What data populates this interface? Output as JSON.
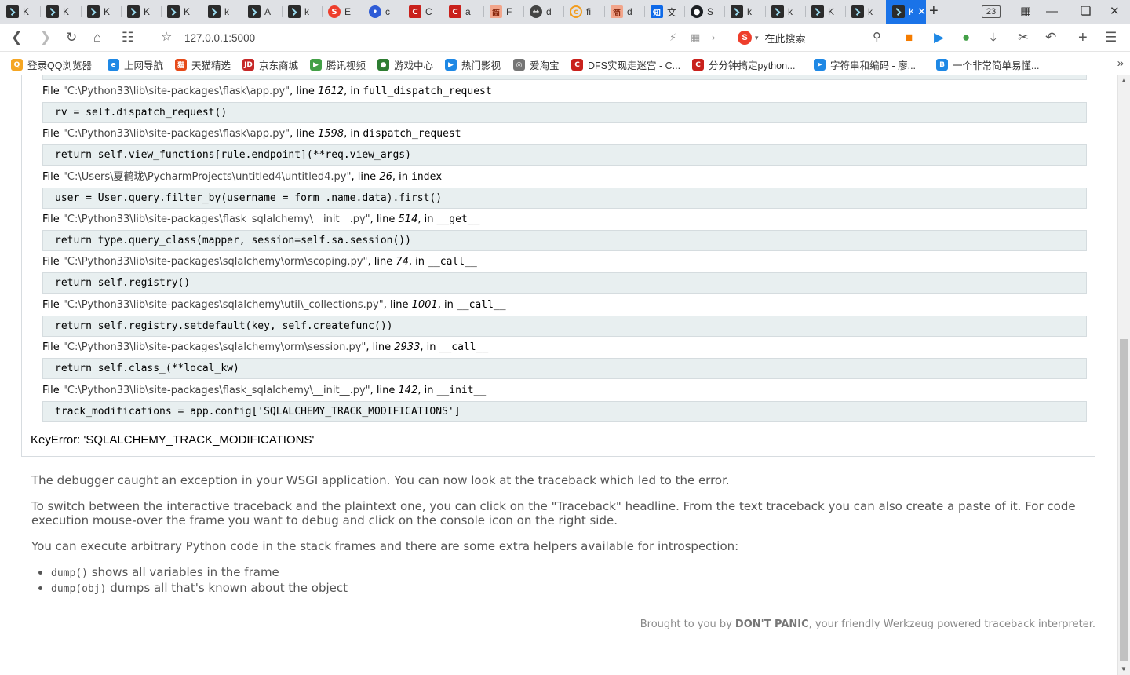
{
  "browser": {
    "tabs": [
      {
        "icon": "terminal-icon",
        "label": "K"
      },
      {
        "icon": "terminal-icon",
        "label": "K"
      },
      {
        "icon": "terminal-icon",
        "label": "K"
      },
      {
        "icon": "terminal-icon",
        "label": "K"
      },
      {
        "icon": "terminal-icon",
        "label": "K"
      },
      {
        "icon": "terminal-icon",
        "label": "k"
      },
      {
        "icon": "terminal-icon",
        "label": "A"
      },
      {
        "icon": "terminal-icon",
        "label": "k"
      },
      {
        "icon": "sogou-icon",
        "label": "E"
      },
      {
        "icon": "baidu-icon",
        "label": "c"
      },
      {
        "icon": "csdn-icon",
        "label": "C"
      },
      {
        "icon": "csdn-icon",
        "label": "a"
      },
      {
        "icon": "jianshu-icon",
        "label": "F"
      },
      {
        "icon": "dark-icon",
        "label": "d"
      },
      {
        "icon": "orange-icon",
        "label": "fi"
      },
      {
        "icon": "jianshu-icon",
        "label": "d"
      },
      {
        "icon": "zhihu-icon",
        "label": "文"
      },
      {
        "icon": "github-icon",
        "label": "S"
      },
      {
        "icon": "terminal-icon",
        "label": "k"
      },
      {
        "icon": "terminal-icon",
        "label": "k"
      },
      {
        "icon": "terminal-icon",
        "label": "K"
      },
      {
        "icon": "terminal-icon",
        "label": "k"
      },
      {
        "icon": "terminal-icon",
        "label": "K"
      }
    ],
    "tab_count": "23",
    "url": "127.0.0.1:5000",
    "search_placeholder": "在此搜索",
    "bookmarks": [
      {
        "label": "登录QQ浏览器",
        "color": "#f5a623"
      },
      {
        "label": "上网导航",
        "color": "#1e88e5"
      },
      {
        "label": "天猫精选",
        "color": "#e64a19"
      },
      {
        "label": "京东商城",
        "color": "#c62828"
      },
      {
        "label": "腾讯视频",
        "color": "#43a047"
      },
      {
        "label": "游戏中心",
        "color": "#2e7d32"
      },
      {
        "label": "热门影视",
        "color": "#1e88e5"
      },
      {
        "label": "爱淘宝",
        "color": "#757575"
      },
      {
        "label": "DFS实现走迷宫 - C...",
        "color": "#c9211c"
      },
      {
        "label": "分分钟搞定python...",
        "color": "#c9211c"
      },
      {
        "label": "字符串和编码 - 廖...",
        "color": "#1e88e5"
      },
      {
        "label": "一个非常简单易懂...",
        "color": "#1e88e5"
      }
    ]
  },
  "traceback": {
    "frames": [
      {
        "file": "\"C:\\Python33\\lib\\site-packages\\flask\\app.py\"",
        "line": "1612",
        "func": "full_dispatch_request",
        "code": "rv = self.dispatch_request()"
      },
      {
        "file": "\"C:\\Python33\\lib\\site-packages\\flask\\app.py\"",
        "line": "1598",
        "func": "dispatch_request",
        "code": "return self.view_functions[rule.endpoint](**req.view_args)"
      },
      {
        "file": "\"C:\\Users\\夏鹤珑\\PycharmProjects\\untitled4\\untitled4.py\"",
        "line": "26",
        "func": "index",
        "code": "user = User.query.filter_by(username = form .name.data).first()"
      },
      {
        "file": "\"C:\\Python33\\lib\\site-packages\\flask_sqlalchemy\\__init__.py\"",
        "line": "514",
        "func": "__get__",
        "code": "return type.query_class(mapper, session=self.sa.session())"
      },
      {
        "file": "\"C:\\Python33\\lib\\site-packages\\sqlalchemy\\orm\\scoping.py\"",
        "line": "74",
        "func": "__call__",
        "code": "return self.registry()"
      },
      {
        "file": "\"C:\\Python33\\lib\\site-packages\\sqlalchemy\\util\\_collections.py\"",
        "line": "1001",
        "func": "__call__",
        "code": "return self.registry.setdefault(key, self.createfunc())"
      },
      {
        "file": "\"C:\\Python33\\lib\\site-packages\\sqlalchemy\\orm\\session.py\"",
        "line": "2933",
        "func": "__call__",
        "code": "return self.class_(**local_kw)"
      },
      {
        "file": "\"C:\\Python33\\lib\\site-packages\\flask_sqlalchemy\\__init__.py\"",
        "line": "142",
        "func": "__init__",
        "code": "track_modifications = app.config['SQLALCHEMY_TRACK_MODIFICATIONS']"
      }
    ],
    "file_prefix": "File ",
    "line_prefix": ", line ",
    "in_prefix": ", in ",
    "error": "KeyError: 'SQLALCHEMY_TRACK_MODIFICATIONS'"
  },
  "explanation": {
    "p1": "The debugger caught an exception in your WSGI application. You can now look at the traceback which led to the error.",
    "p2": "To switch between the interactive traceback and the plaintext one, you can click on the \"Traceback\" headline. From the text traceback you can also create a paste of it. For code execution mouse-over the frame you want to debug and click on the console icon on the right side.",
    "p3": "You can execute arbitrary Python code in the stack frames and there are some extra helpers available for introspection:",
    "bullets": [
      {
        "code": "dump()",
        "text": " shows all variables in the frame"
      },
      {
        "code": "dump(obj)",
        "text": " dumps all that's known about the object"
      }
    ]
  },
  "footer": {
    "prefix": "Brought to you by ",
    "brand": "DON'T PANIC",
    "suffix": ", your friendly Werkzeug powered traceback interpreter."
  }
}
